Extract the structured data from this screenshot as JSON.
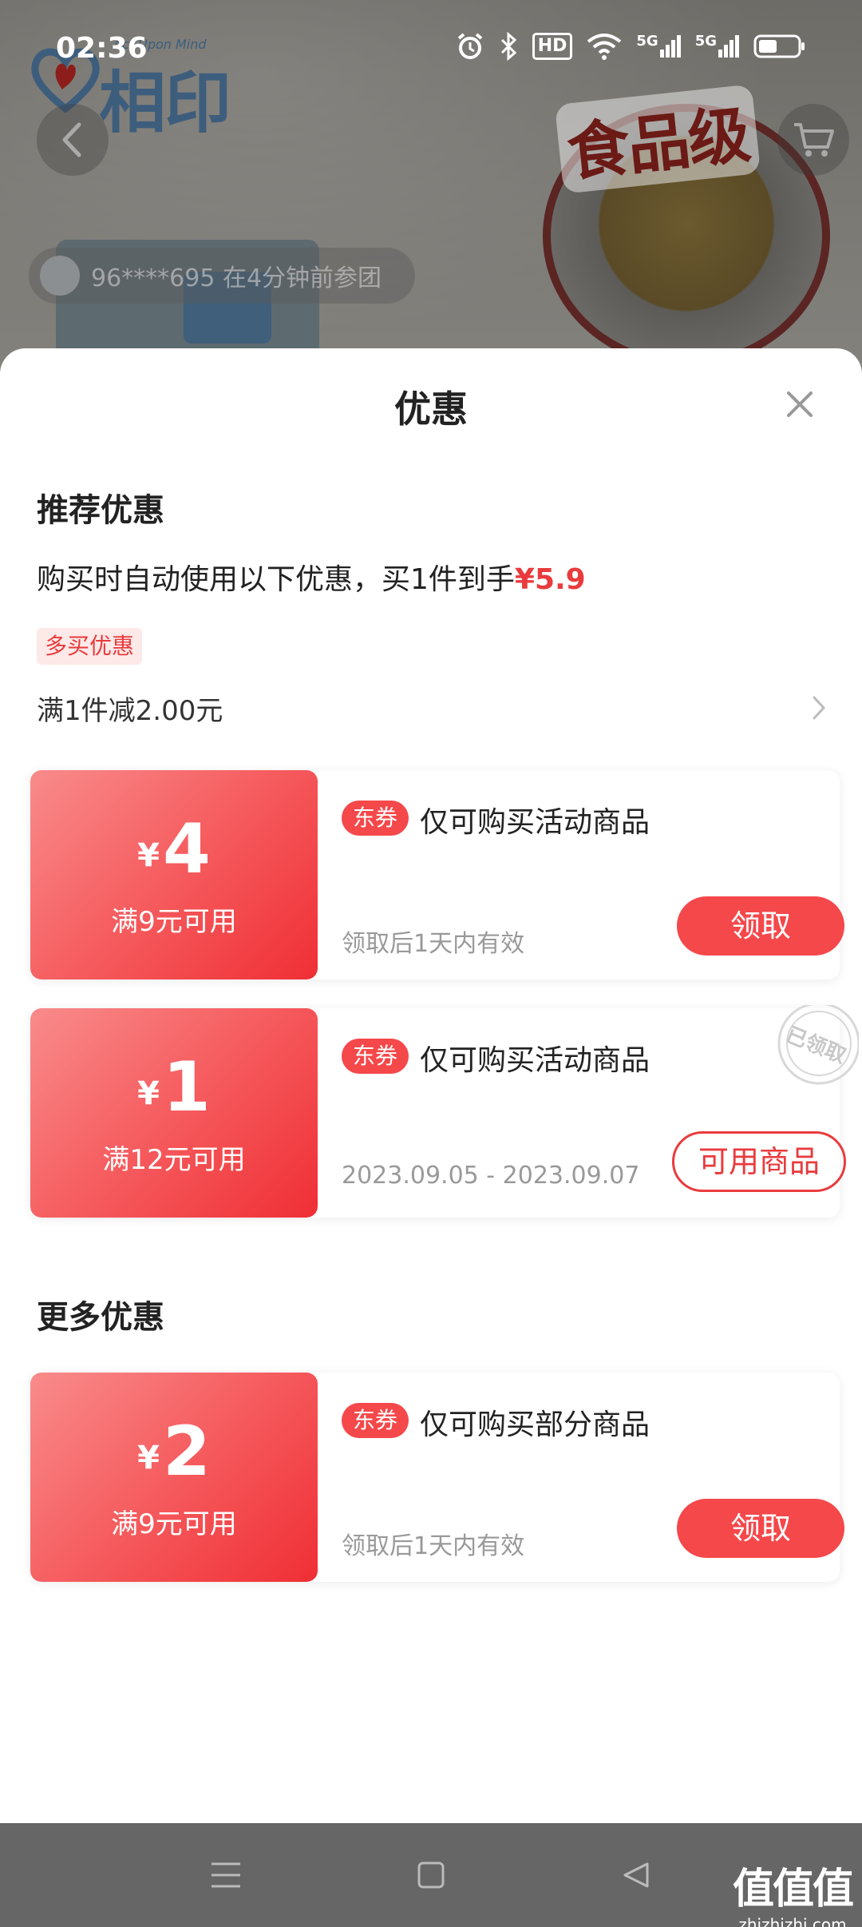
{
  "status_bar": {
    "time": "02:36",
    "icons": [
      "alarm-icon",
      "bluetooth-icon",
      "hd-icon",
      "wifi-icon",
      "signal-5g-icon",
      "signal-5g-icon",
      "battery-icon"
    ],
    "hd_label": "HD",
    "net1": "5G",
    "net2": "5G"
  },
  "product_bg": {
    "brand": "相印",
    "slogan": "Act Upon Mind",
    "badge": "食品级",
    "group_text": "96****695  在4分钟前参团"
  },
  "sheet": {
    "title": "优惠",
    "recommend": {
      "title": "推荐优惠",
      "auto_prefix": "购买时自动使用以下优惠，买1件到手",
      "auto_price": "¥5.9",
      "tag": "多买优惠",
      "rule": "满1件减2.00元"
    },
    "coupons": [
      {
        "yen": "¥",
        "amount": "4",
        "condition": "满9元可用",
        "tag": "东券",
        "desc": "仅可购买活动商品",
        "validity": "领取后1天内有效",
        "action": "领取",
        "claimed": false
      },
      {
        "yen": "¥",
        "amount": "1",
        "condition": "满12元可用",
        "tag": "东券",
        "desc": "仅可购买活动商品",
        "validity": "2023.09.05 - 2023.09.07",
        "action": "可用商品",
        "claimed": true,
        "stamp": "已领取"
      }
    ],
    "more": {
      "title": "更多优惠",
      "coupons": [
        {
          "yen": "¥",
          "amount": "2",
          "condition": "满9元可用",
          "tag": "东券",
          "desc": "仅可购买部分商品",
          "validity": "领取后1天内有效",
          "action": "领取"
        }
      ]
    }
  },
  "navbar": {
    "buttons": [
      "menu-icon",
      "home-square-icon",
      "back-triangle-icon"
    ],
    "watermark_big": "值值值",
    "watermark_small": "zhizhizhi.com"
  },
  "colors": {
    "accent": "#e93b3d",
    "coupon_gradient_start": "#f98b8b",
    "coupon_gradient_end": "#ef2f35"
  }
}
